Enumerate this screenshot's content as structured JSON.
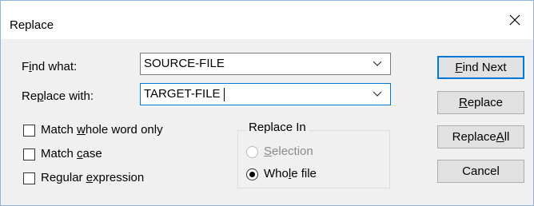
{
  "window": {
    "title": "Replace",
    "close_icon": "close-icon"
  },
  "find": {
    "label_pre": "F",
    "label_ul": "i",
    "label_post": "nd what:",
    "value": "SOURCE-FILE"
  },
  "replace": {
    "label_pre": "Re",
    "label_ul": "p",
    "label_post": "lace with:",
    "value": "TARGET-FILE"
  },
  "options": {
    "whole_word": {
      "pre": "Match ",
      "ul": "w",
      "post": "hole word only",
      "checked": false
    },
    "match_case": {
      "pre": "Match ",
      "ul": "c",
      "post": "ase",
      "checked": false
    },
    "regex": {
      "pre": "Regular ",
      "ul": "e",
      "post": "xpression",
      "checked": false
    }
  },
  "replace_in": {
    "label": "Replace In",
    "selection": {
      "pre": "",
      "ul": "S",
      "post": "election",
      "selected": false,
      "enabled": false
    },
    "whole_file": {
      "pre": "Who",
      "ul": "l",
      "post": "e file",
      "selected": true,
      "enabled": true
    }
  },
  "buttons": {
    "find_next": {
      "pre": "",
      "ul": "F",
      "post": "ind Next"
    },
    "replace": {
      "pre": "",
      "ul": "R",
      "post": "eplace"
    },
    "replace_all": {
      "pre": "Replace ",
      "ul": "A",
      "post": "ll"
    },
    "cancel": {
      "pre": "",
      "ul": "",
      "post": "Cancel"
    }
  },
  "colors": {
    "accent": "#0078d7",
    "dialog_bg": "#f0f0f0",
    "button_bg": "#e1e1e1"
  }
}
